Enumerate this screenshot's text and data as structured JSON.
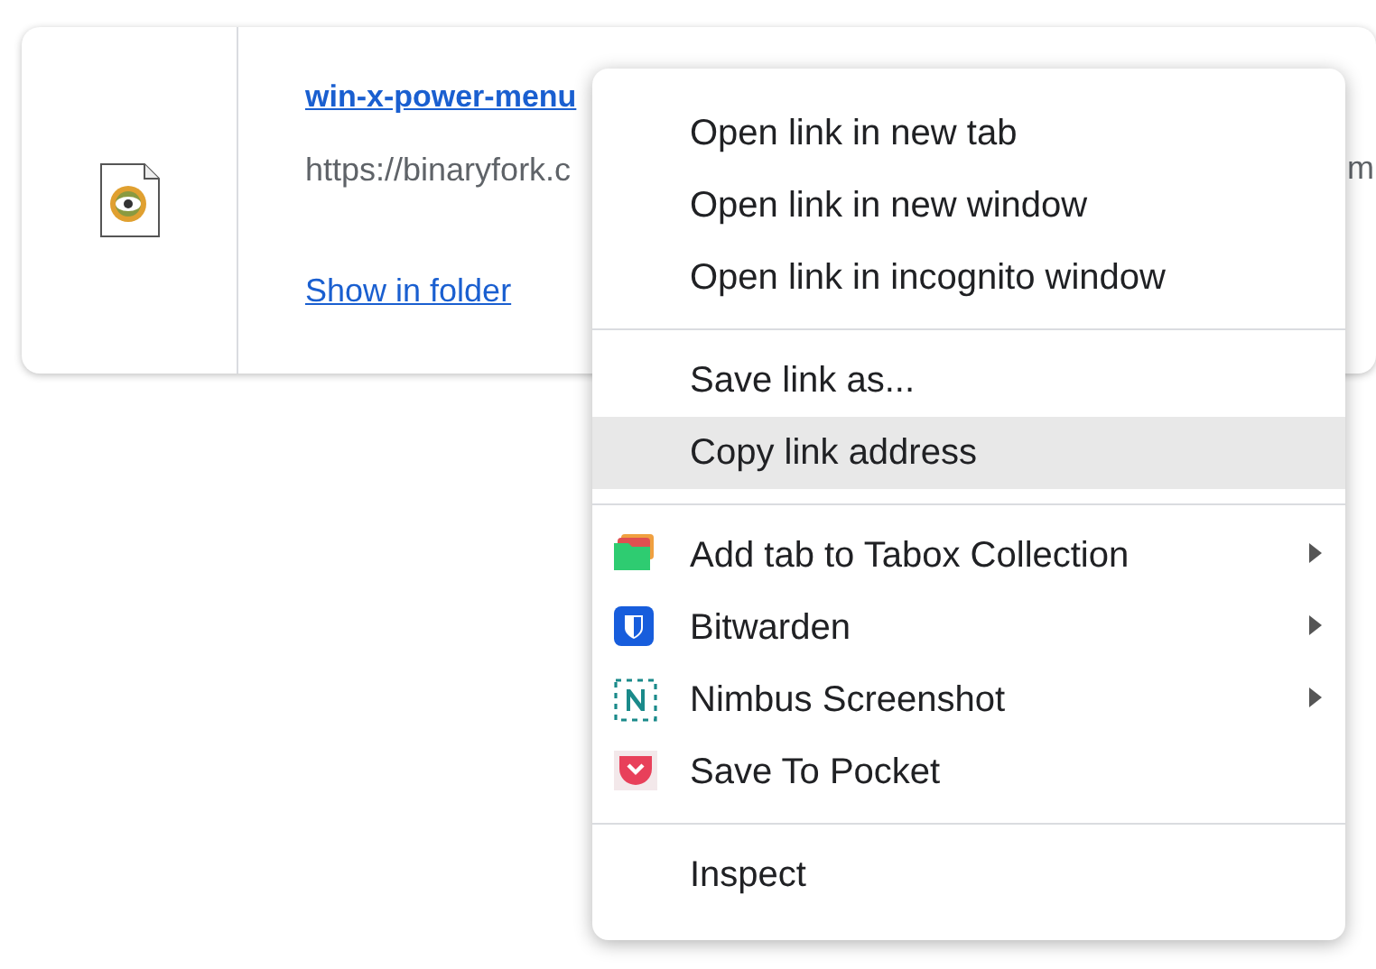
{
  "download": {
    "title": "win-x-power-menu",
    "url": "https://binaryfork.c",
    "url_tail": "m",
    "action": "Show in folder"
  },
  "menu": [
    {
      "kind": "item",
      "label": "Open link in new tab",
      "selected": false
    },
    {
      "kind": "item",
      "label": "Open link in new window",
      "selected": false
    },
    {
      "kind": "item",
      "label": "Open link in incognito window",
      "selected": false
    },
    {
      "kind": "separator"
    },
    {
      "kind": "item",
      "label": "Save link as...",
      "selected": false
    },
    {
      "kind": "item",
      "label": "Copy link address",
      "selected": true
    },
    {
      "kind": "separator"
    },
    {
      "kind": "extension",
      "label": "Add tab to Tabox Collection",
      "selected": false,
      "submenu": true
    },
    {
      "kind": "extension",
      "label": "Bitwarden",
      "selected": false,
      "submenu": true
    },
    {
      "kind": "extension",
      "label": "Nimbus Screenshot",
      "selected": false,
      "submenu": true
    },
    {
      "kind": "extension",
      "label": "Save To Pocket",
      "selected": false,
      "submenu": false
    },
    {
      "kind": "separator"
    },
    {
      "kind": "item",
      "label": "Inspect",
      "selected": false
    }
  ]
}
